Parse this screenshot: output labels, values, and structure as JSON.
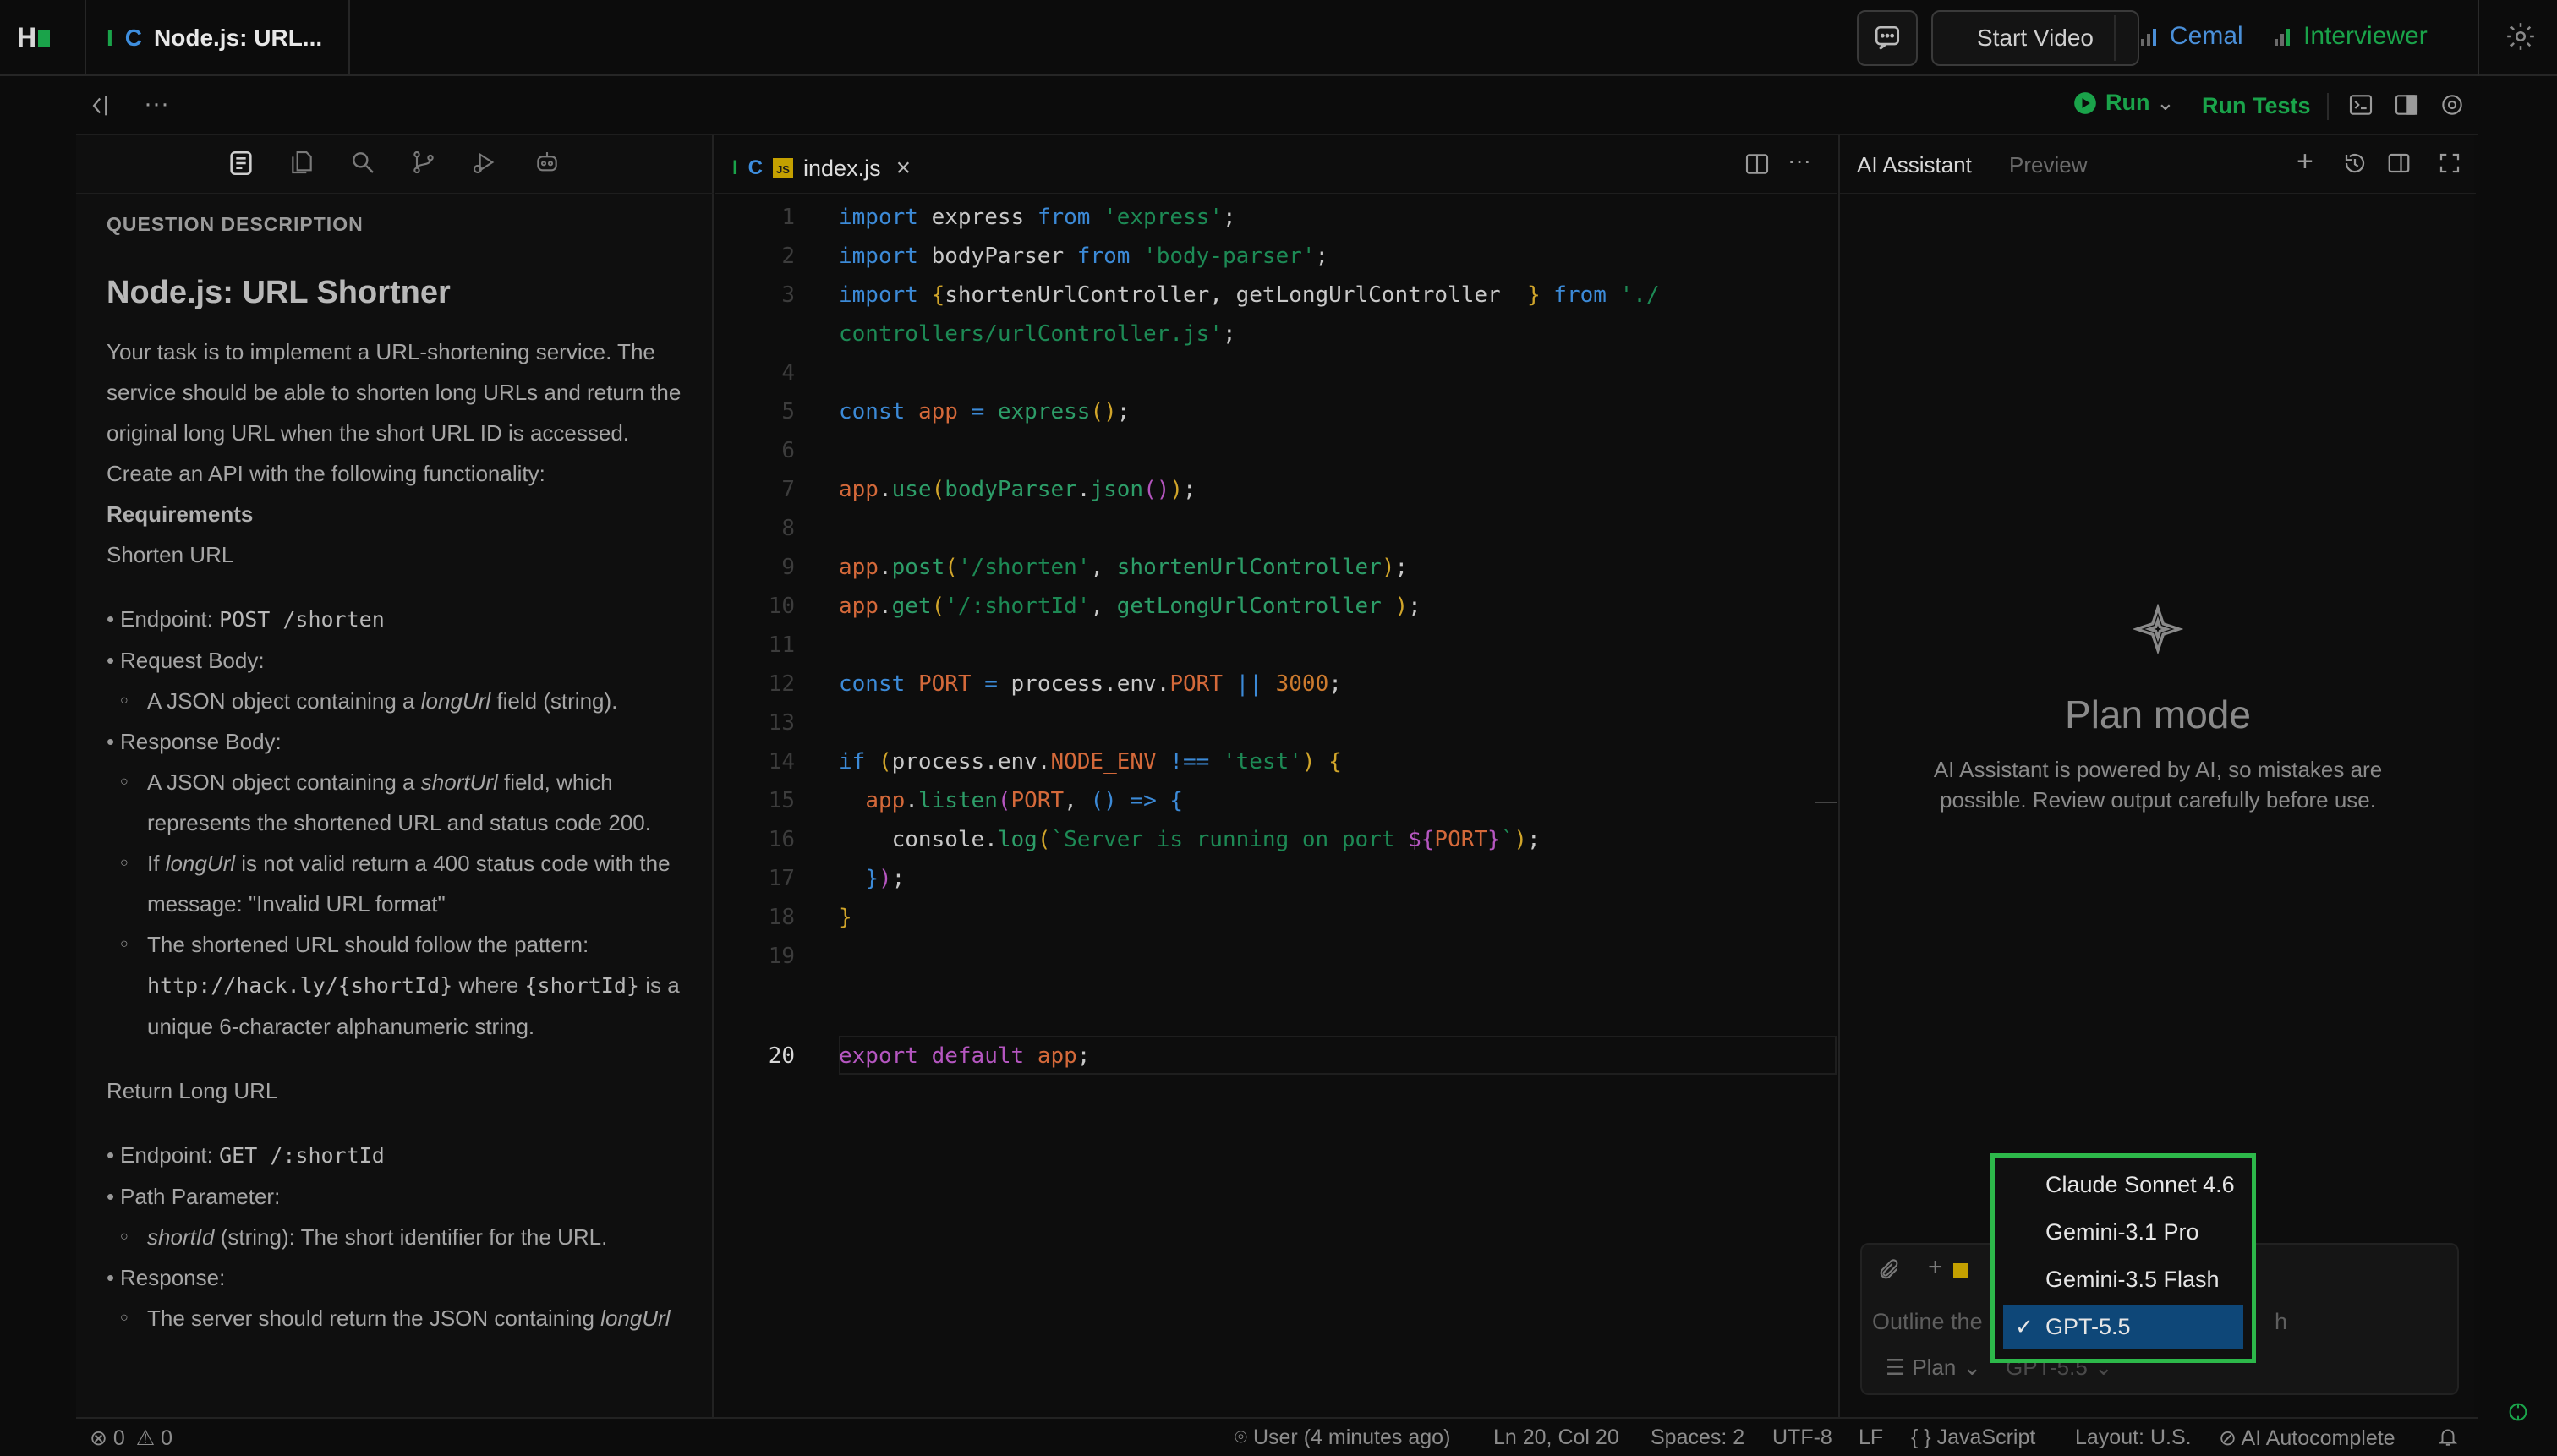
{
  "topbar": {
    "logo": "H",
    "tab_lang_i": "I",
    "tab_lang_c": "C",
    "tab_title": "Node.js: URL...",
    "start_video": "Start Video",
    "participant_1": "Cemal",
    "participant_2": "Interviewer"
  },
  "toolbar": {
    "run": "Run",
    "run_tests": "Run Tests"
  },
  "left": {
    "section_caption": "QUESTION DESCRIPTION",
    "title": "Node.js: URL Shortner",
    "intro": "Your task is to implement a URL-shortening service. The service should be able to shorten long URLs and return the original long URL when the short URL ID is accessed.",
    "create_api": "Create an API with the following functionality:",
    "requirements": "Requirements",
    "shorten_url": "Shorten URL",
    "endpoint_label": "Endpoint: ",
    "shorten_endpoint": "POST /shorten",
    "request_body": "Request Body:",
    "req_body_a": "A JSON object containing a ",
    "long_url": "longUrl",
    "req_body_b": " field (string).",
    "response_body": "Response Body:",
    "resp_a": "A JSON object containing a ",
    "short_url": "shortUrl",
    "resp_b": " field, which represents the shortened URL and status code 200.",
    "if_word": "If ",
    "invalid_b": " is not valid return a 400 status code with the message: \"Invalid URL format\"",
    "pattern_a": "The shortened URL should follow the pattern: ",
    "pattern_code": "http://hack.ly/{shortId}",
    "pattern_where": " where ",
    "pattern_shortid": "{shortId}",
    "pattern_b": " is a unique 6-character alphanumeric string.",
    "return_long": "Return Long URL",
    "get_endpoint": "GET /:shortId",
    "path_param": "Path Parameter:",
    "shortid_word": "shortId",
    "shortid_desc": " (string): The short identifier for the URL.",
    "response": "Response:",
    "server_return": "The server should return the JSON containing "
  },
  "editor": {
    "tab_lang_i": "I",
    "tab_lang_c": "C",
    "js_badge": "JS",
    "file_name": "index.js",
    "active_line": 20
  },
  "ai": {
    "tab_assistant": "AI Assistant",
    "tab_preview": "Preview",
    "plan_title": "Plan mode",
    "plan_subtitle": "AI Assistant is powered by AI, so mistakes are possible. Review output carefully before use.",
    "input_placeholder": "Outline the",
    "input_placeholder_tail": "h",
    "mode_label": "Plan",
    "model_label": "GPT-5.5",
    "models": [
      "Claude Sonnet 4.6",
      "Gemini-3.1 Pro",
      "Gemini-3.5 Flash",
      "GPT-5.5"
    ],
    "selected_model": "GPT-5.5"
  },
  "status": {
    "errors": "0",
    "warnings": "0",
    "user": "User (4 minutes ago)",
    "position": "Ln 20, Col 20",
    "spaces": "Spaces: 2",
    "encoding": "UTF-8",
    "eol": "LF",
    "language": "JavaScript",
    "layout": "Layout: U.S.",
    "autocomplete": "AI Autocomplete"
  },
  "colors": {
    "accent_green": "#1aa34a",
    "accent_blue": "#3e8ede",
    "dropdown_border": "#2db84a",
    "selected_bg": "#0e4778"
  }
}
